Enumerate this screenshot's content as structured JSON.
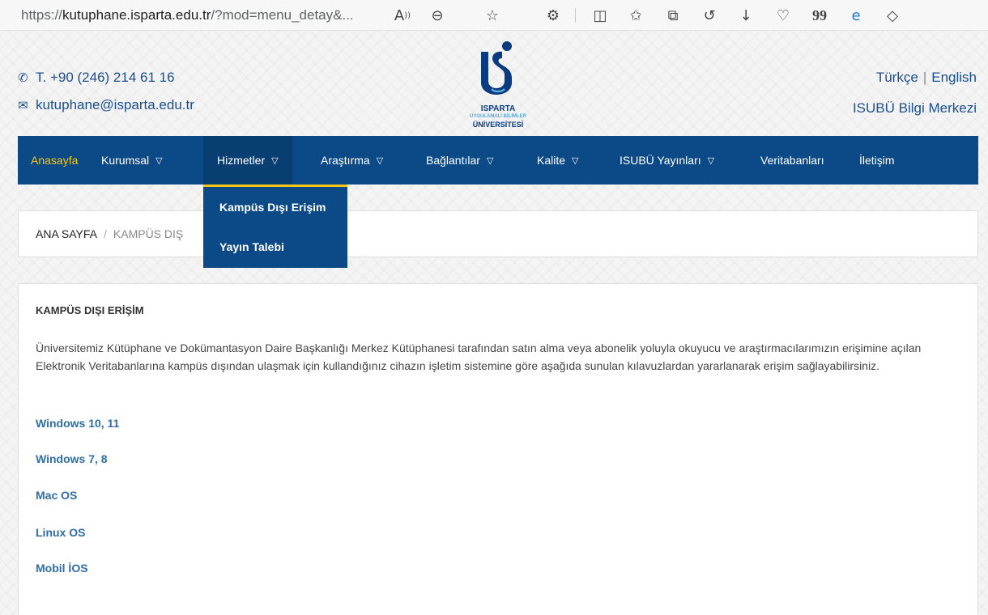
{
  "browser": {
    "url_prefix": "https://",
    "url_domain": "kutuphane.isparta.edu.tr",
    "url_rest": "/?mod=menu_detay&...",
    "icons": [
      "read-aloud",
      "zoom-out",
      "favorite-star",
      "extensions",
      "split-screen",
      "favorites-list",
      "collections",
      "history",
      "downloads",
      "browser-health",
      "quote",
      "edge",
      "copilot"
    ]
  },
  "header": {
    "phone": "T. +90 (246) 214 61 16",
    "email": "kutuphane@isparta.edu.tr",
    "logo": {
      "line1": "ISPARTA",
      "line2": "UYGULAMALI BİLİMLER",
      "line3": "ÜNİVERSİTESİ"
    },
    "lang_tr": "Türkçe",
    "lang_sep": "|",
    "lang_en": "English",
    "subtitle": "ISUBÜ Bilgi Merkezi"
  },
  "nav": {
    "items": [
      {
        "label": "Anasayfa"
      },
      {
        "label": "Kurumsal"
      },
      {
        "label": "Hizmetler"
      },
      {
        "label": "Araştırma"
      },
      {
        "label": "Bağlantılar"
      },
      {
        "label": "Kalite"
      },
      {
        "label": "ISUBÜ Yayınları"
      },
      {
        "label": "Veritabanları"
      },
      {
        "label": "İletişim"
      }
    ],
    "dropdown": [
      "Kampüs Dışı Erişim",
      "Yayın Talebi"
    ]
  },
  "breadcrumb": {
    "home": "ANA SAYFA",
    "sep": "/",
    "current": "KAMPÜS DIŞ"
  },
  "content": {
    "title": "KAMPÜS DIŞI ERİŞİM",
    "text": "Üniversitemiz Kütüphane ve Dokümantasyon Daire Başkanlığı Merkez Kütüphanesi tarafından satın alma veya abonelik yoluyla okuyucu ve araştırmacılarımızın erişimine açılan Elektronik Veritabanlarına kampüs dışından ulaşmak için kullandığınız cihazın işletim sistemine göre aşağıda sunulan kılavuzlardan yararlanarak erişim sağlayabilirsiniz.",
    "links": [
      "Windows 10, 11",
      "Windows 7, 8",
      "Mac OS",
      "Linux OS",
      "Mobil İOS"
    ]
  },
  "colors": {
    "nav_bg": "#0b4a87",
    "accent": "#f5c518",
    "link": "#2f6da7",
    "header_text": "#1a4f8f"
  }
}
